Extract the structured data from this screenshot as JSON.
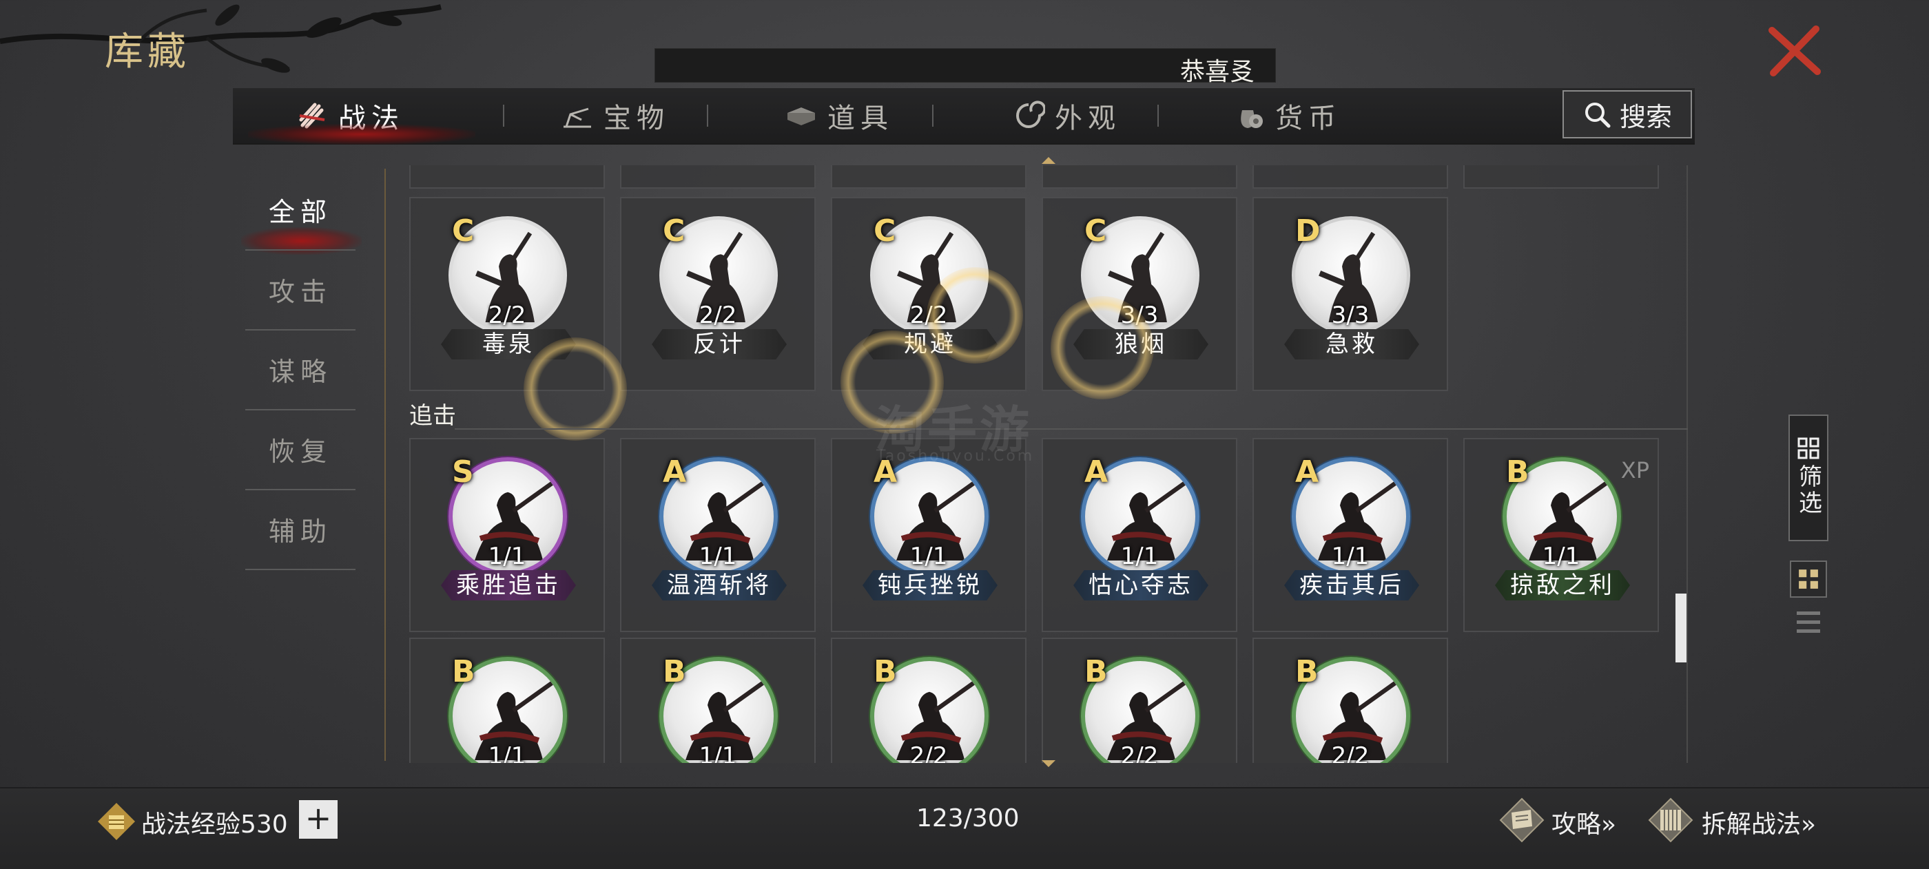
{
  "header": {
    "title": "库藏",
    "marquee_text": "恭喜㕛"
  },
  "tabs": [
    {
      "label": "战法",
      "icon": "scroll-bundle-icon",
      "active": true
    },
    {
      "label": "宝物",
      "icon": "treasure-icon",
      "active": false
    },
    {
      "label": "道具",
      "icon": "book-stack-icon",
      "active": false
    },
    {
      "label": "外观",
      "icon": "swirl-icon",
      "active": false
    },
    {
      "label": "货币",
      "icon": "coin-bag-icon",
      "active": false
    }
  ],
  "search": {
    "label": "搜索"
  },
  "categories": [
    {
      "label": "全部",
      "active": true
    },
    {
      "label": "攻击",
      "active": false
    },
    {
      "label": "谋略",
      "active": false
    },
    {
      "label": "恢复",
      "active": false
    },
    {
      "label": "辅助",
      "active": false
    }
  ],
  "row1": [
    {
      "grade": "C",
      "count": "2/2",
      "name": "毒泉"
    },
    {
      "grade": "C",
      "count": "2/2",
      "name": "反计"
    },
    {
      "grade": "C",
      "count": "2/2",
      "name": "规避"
    },
    {
      "grade": "C",
      "count": "3/3",
      "name": "狼烟"
    },
    {
      "grade": "D",
      "count": "3/3",
      "name": "急救"
    }
  ],
  "section": {
    "label": "追击"
  },
  "row2": [
    {
      "grade": "S",
      "count": "1/1",
      "name": "乘胜追击"
    },
    {
      "grade": "A",
      "count": "1/1",
      "name": "温酒斩将"
    },
    {
      "grade": "A",
      "count": "1/1",
      "name": "钝兵挫锐"
    },
    {
      "grade": "A",
      "count": "1/1",
      "name": "怙心夺志"
    },
    {
      "grade": "A",
      "count": "1/1",
      "name": "疾击其后"
    },
    {
      "grade": "B",
      "count": "1/1",
      "name": "掠敌之利",
      "badge": "XP"
    }
  ],
  "row3": [
    {
      "grade": "B",
      "count": "1/1"
    },
    {
      "grade": "B",
      "count": "1/1"
    },
    {
      "grade": "B",
      "count": "2/2"
    },
    {
      "grade": "B",
      "count": "2/2"
    },
    {
      "grade": "B",
      "count": "2/2"
    }
  ],
  "watermark": {
    "text": "淘手游",
    "sub": "Taoshouyou.Com"
  },
  "filter": {
    "label": "筛选"
  },
  "footer": {
    "exp_label": "战法经验530",
    "plus": "+",
    "capacity": "123/300",
    "guide": "攻略»",
    "decompose": "拆解战法»"
  },
  "colors": {
    "accent_gold": "#d8c28a",
    "grade_text": "#f3d36b",
    "close_red": "#c0392b",
    "tab_glow": "#aa1414",
    "ring_s": "#a055b7",
    "ring_a": "#4f7fb4",
    "ring_b": "#5f9a58",
    "ring_c": "#dcdcdc"
  }
}
